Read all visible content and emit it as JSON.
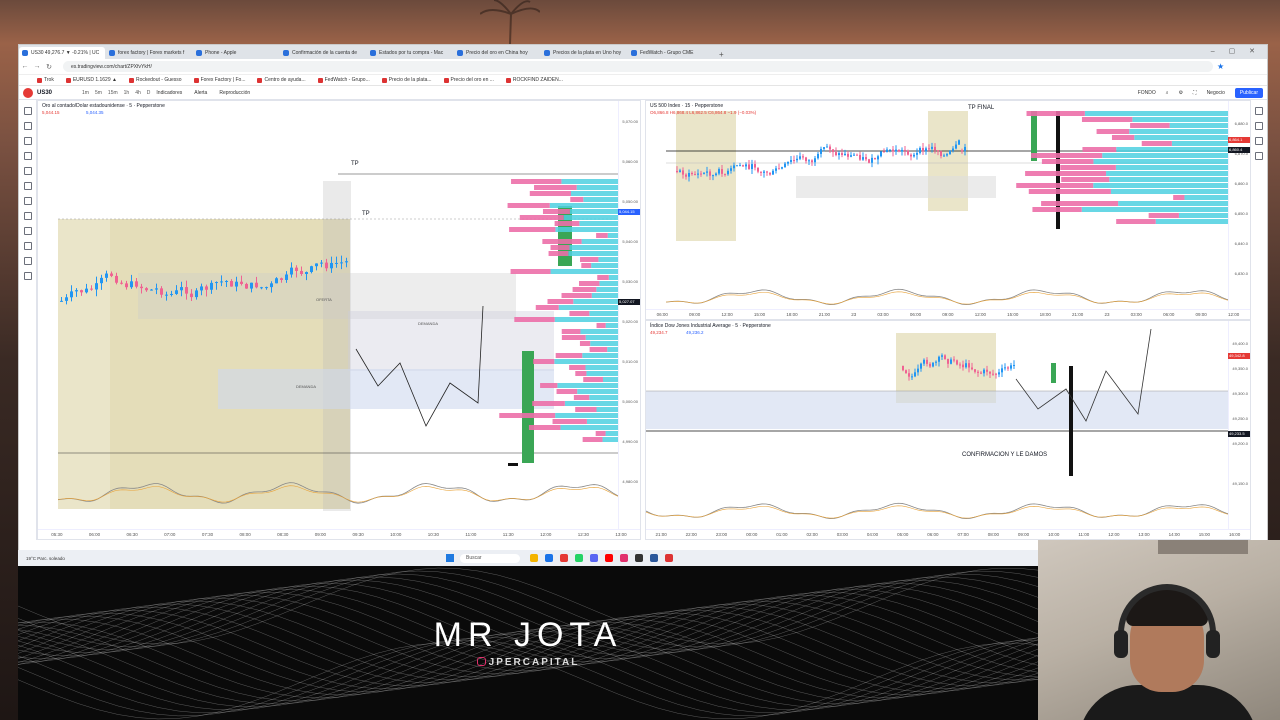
{
  "browser": {
    "tabs": [
      {
        "label": "US30 49,276.7 ▼ -0.21% | UC"
      },
      {
        "label": "forex factory | Forex markets f"
      },
      {
        "label": "Phone - Apple"
      },
      {
        "label": "Confirmación de la cuenta de"
      },
      {
        "label": "Estados por tu compra - Mac"
      },
      {
        "label": "Precio del oro en China hoy"
      },
      {
        "label": "Precios de la plata en Uno hoy"
      },
      {
        "label": "FedWatch - Grupo CME"
      }
    ],
    "new_tab": "+",
    "window_controls": "– ▢ ✕",
    "url": "es.tradingview.com/chart/ZPXfvYkH/",
    "bookmarks": [
      {
        "label": "Trok"
      },
      {
        "label": "EURUSD 1.1629 ▲"
      },
      {
        "label": "Rockedout - Guesso"
      },
      {
        "label": "Forex Factory | Fo..."
      },
      {
        "label": "Centro de ayuda..."
      },
      {
        "label": "FedWatch - Grupo..."
      },
      {
        "label": "Precio de la plata..."
      },
      {
        "label": "Precio del oro en ..."
      },
      {
        "label": "ROCKFIND ZAIDEN..."
      }
    ]
  },
  "toolbar": {
    "symbol": "US30",
    "timeframes": [
      "1m",
      "5m",
      "15m",
      "1h",
      "4h",
      "D"
    ],
    "indicators": "Indicadores",
    "alert": "Alerta",
    "replay": "Reproducción",
    "right_items": [
      "FONDO",
      "Negocio"
    ],
    "publish": "Publicar"
  },
  "panes": {
    "gold": {
      "title": "Oro al contado/Dolar estadounidense · 5 · Pepperstone",
      "ohlc": "O5,042.95 H5,044.89 L5,040.82 C5,041.29 −1.79 (−0.03%)",
      "sell": "5,044.15",
      "buy": "5,044.35",
      "annotations": {
        "tp_top": "TP",
        "tp_mid": "TP",
        "demanda_1": "DEMANDA",
        "demanda_2": "DEMANDA",
        "oferta": "OFERTA"
      },
      "prices": [
        "5,070.00",
        "5,060.00",
        "5,050.00",
        "5,040.00",
        "5,030.00",
        "5,020.00",
        "5,010.00",
        "5,000.00",
        "4,990.00",
        "4,980.00"
      ],
      "tags": [
        "5,044.15",
        "5,027.07"
      ],
      "times": [
        "05:30",
        "06:00",
        "06:30",
        "07:00",
        "07:30",
        "08:00",
        "08:30",
        "09:00",
        "09:30",
        "10:00",
        "10:30",
        "11:00",
        "11:30",
        "12:00",
        "12:30",
        "13:00"
      ]
    },
    "sp500": {
      "title": "US 500 Index · 15 · Pepperstone",
      "ohlc": "O6,866.8 H6,868.4 L6,862.5 C6,864.8 −1.9 (−0.03%)",
      "annotation": "TP FINAL",
      "prices": [
        "6,880.0",
        "6,870.0",
        "6,860.0",
        "6,850.0",
        "6,840.0",
        "6,830.0"
      ],
      "tags": [
        "6,864.1",
        "6,860.4"
      ],
      "times": [
        "06:00",
        "09:00",
        "12:00",
        "15:00",
        "18:00",
        "21:00",
        "23",
        "03:00",
        "06:00",
        "09:00",
        "12:00",
        "15:00",
        "18:00",
        "21:00",
        "23",
        "03:00",
        "06:00",
        "09:00",
        "12:00"
      ]
    },
    "dow": {
      "title": "Índice Dow Jones Industrial Average · 5 · Pepperstone",
      "ohlc": "O49,236.8 H49,238.3 L49,232.6 C49,233.5 −3.8 (−0.01%)",
      "sell": "49,234.7",
      "buy": "49,236.2",
      "annotation": "CONFIRMACION Y LE DAMOS",
      "prices": [
        "49,400.0",
        "49,350.0",
        "49,300.0",
        "49,250.0",
        "49,200.0",
        "49,150.0"
      ],
      "tags": [
        "49,342.8",
        "49,233.5"
      ],
      "times": [
        "21:00",
        "22:00",
        "23:00",
        "00:00",
        "01:00",
        "02:00",
        "03:00",
        "04:00",
        "05:00",
        "06:00",
        "07:00",
        "08:00",
        "09:00",
        "10:00",
        "11:00",
        "12:00",
        "13:00",
        "14:00",
        "15:00",
        "16:00"
      ]
    }
  },
  "taskbar": {
    "weather": "19°C Parc. soleado",
    "search": "Buscar"
  },
  "banner": {
    "title": "MR JOTA",
    "handle": "JPERCAPITAL"
  },
  "colors": {
    "bull": "#2196f3",
    "bear": "#f06292",
    "vp_cyan": "#4dd0e1",
    "vp_pink": "#ec6fa8",
    "zone_tan": "#d9cf9c",
    "accent": "#2962ff"
  }
}
